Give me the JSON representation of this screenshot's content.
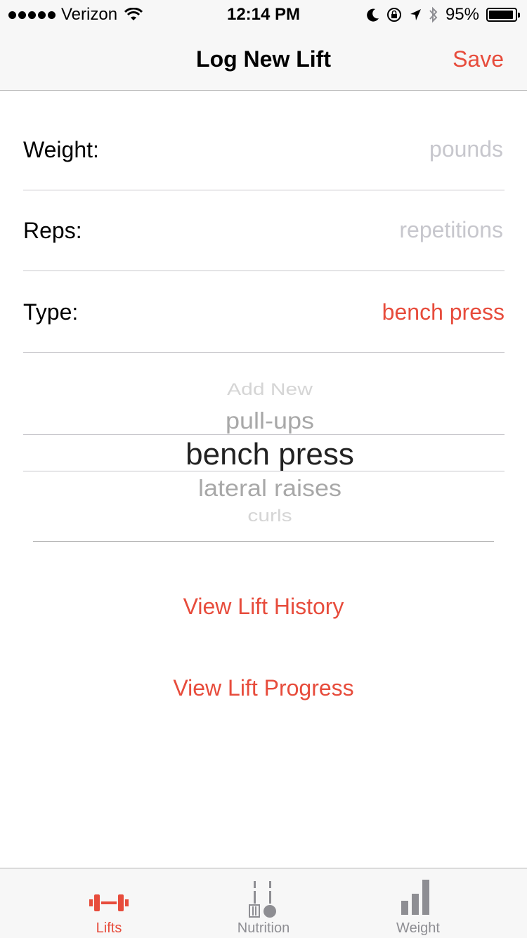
{
  "status_bar": {
    "carrier": "Verizon",
    "time": "12:14 PM",
    "battery_percent_text": "95%",
    "battery_level": 0.95
  },
  "nav": {
    "title": "Log New Lift",
    "save_label": "Save"
  },
  "form": {
    "weight_label": "Weight:",
    "weight_placeholder": "pounds",
    "reps_label": "Reps:",
    "reps_placeholder": "repetitions",
    "type_label": "Type:",
    "type_value": "bench press"
  },
  "picker": {
    "items": [
      "Add New",
      "pull-ups",
      "bench press",
      "lateral raises",
      "curls"
    ],
    "selected_index": 2
  },
  "links": {
    "history": "View Lift History",
    "progress": "View Lift Progress"
  },
  "tabs": [
    {
      "label": "Lifts",
      "icon": "barbell-icon",
      "active": true
    },
    {
      "label": "Nutrition",
      "icon": "fork-knife-icon",
      "active": false
    },
    {
      "label": "Weight",
      "icon": "bar-chart-icon",
      "active": false
    }
  ],
  "colors": {
    "accent": "#e74c3c",
    "inactive_tab": "#8e8e93",
    "placeholder": "#c7c7cd"
  }
}
